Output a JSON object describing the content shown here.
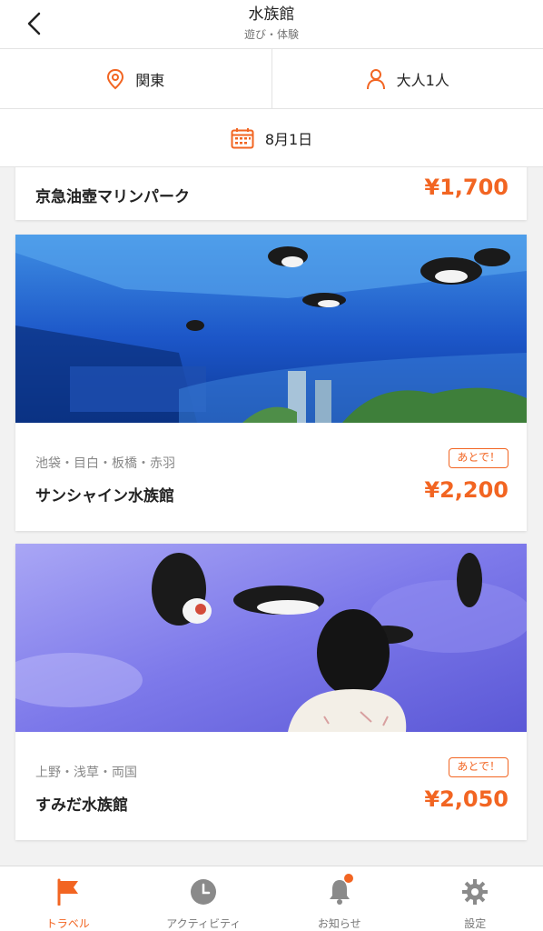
{
  "header": {
    "title": "水族館",
    "subtitle": "遊び・体験"
  },
  "filters": {
    "region": "関東",
    "guests": "大人1人",
    "date": "8月1日"
  },
  "cards": [
    {
      "name": "京急油壺マリンパーク",
      "price": "¥1,700"
    },
    {
      "area": "池袋・目白・板橋・赤羽",
      "name": "サンシャイン水族館",
      "badge": "あとで！",
      "price": "¥2,200"
    },
    {
      "area": "上野・浅草・両国",
      "name": "すみだ水族館",
      "badge": "あとで！",
      "price": "¥2,050"
    }
  ],
  "tabs": [
    {
      "label": "トラベル",
      "icon": "flag-icon",
      "active": true
    },
    {
      "label": "アクティビティ",
      "icon": "clock-icon",
      "active": false
    },
    {
      "label": "お知らせ",
      "icon": "bell-icon",
      "active": false
    },
    {
      "label": "設定",
      "icon": "gear-icon",
      "active": false
    }
  ],
  "colors": {
    "accent": "#f26522"
  }
}
